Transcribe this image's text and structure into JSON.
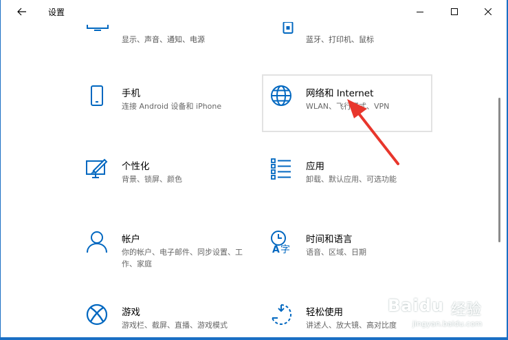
{
  "window": {
    "title": "设置",
    "controls": {
      "back": "back-arrow-icon",
      "minimize": "minimize-icon",
      "maximize": "maximize-icon",
      "close": "close-icon"
    }
  },
  "partial_top": [
    {
      "desc": "显示、声音、通知、电源",
      "icon": "monitor-icon"
    },
    {
      "desc": "蓝牙、打印机、鼠标",
      "icon": "devices-icon"
    }
  ],
  "tiles": {
    "phone": {
      "name": "手机",
      "desc": "连接 Android 设备和 iPhone",
      "icon": "phone-icon"
    },
    "network": {
      "name": "网络和 Internet",
      "desc": "WLAN、飞行模式、VPN",
      "icon": "globe-icon"
    },
    "personal": {
      "name": "个性化",
      "desc": "背景、锁屏、颜色",
      "icon": "personalization-icon"
    },
    "apps": {
      "name": "应用",
      "desc": "卸载、默认应用、可选功能",
      "icon": "apps-list-icon"
    },
    "account": {
      "name": "帐户",
      "desc": "你的帐户、电子邮件、同步设置、工作、家庭",
      "icon": "person-icon"
    },
    "time": {
      "name": "时间和语言",
      "desc": "语音、区域、日期",
      "icon": "time-language-icon"
    },
    "gaming": {
      "name": "游戏",
      "desc": "游戏栏、截屏、直播、游戏模式",
      "icon": "xbox-icon"
    },
    "ease": {
      "name": "轻松使用",
      "desc": "讲述人、放大镜、高对比度",
      "icon": "ease-of-access-icon"
    }
  },
  "watermark": {
    "brand": "Baidu",
    "suffix": "经验",
    "url": "jingyan.baidu.com"
  },
  "colors": {
    "accent": "#0067c0",
    "arrow": "#e8362c",
    "desktop": "#1a6fc4"
  }
}
